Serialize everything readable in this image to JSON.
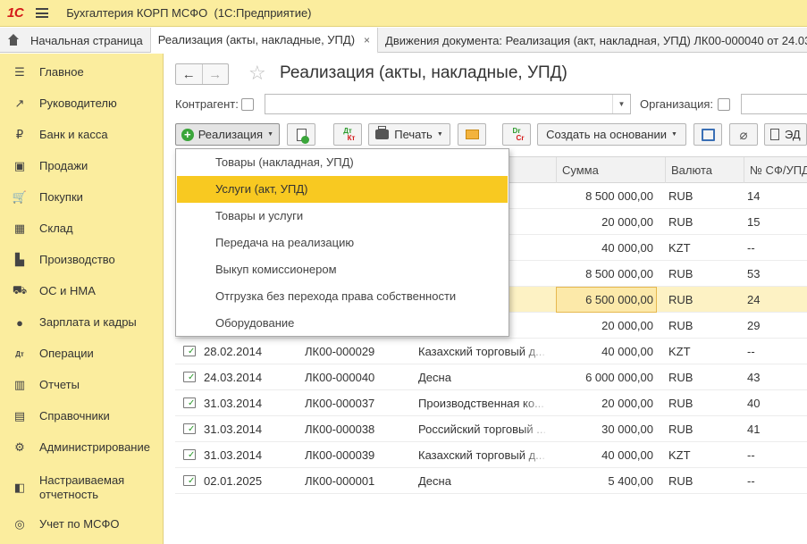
{
  "app": {
    "logo": "1С",
    "title": "Бухгалтерия КОРП МСФО",
    "platform": "(1С:Предприятие)"
  },
  "tabs": [
    {
      "label": "Начальная страница"
    },
    {
      "label": "Реализация (акты, накладные, УПД)",
      "close": "×"
    },
    {
      "label": "Движения документа: Реализация (акт, накладная, УПД) ЛК00-000040 от 24.03"
    }
  ],
  "sidebar": {
    "items": [
      {
        "label": "Главное",
        "icon": "menu-list-icon",
        "glyph": "☰"
      },
      {
        "label": "Руководителю",
        "icon": "trend-chart-icon",
        "glyph": "↗"
      },
      {
        "label": "Банк и касса",
        "icon": "ruble-coin-icon",
        "glyph": "₽"
      },
      {
        "label": "Продажи",
        "icon": "shopping-bag-icon",
        "glyph": "▣"
      },
      {
        "label": "Покупки",
        "icon": "shopping-cart-icon",
        "glyph": "🛒"
      },
      {
        "label": "Склад",
        "icon": "warehouse-grid-icon",
        "glyph": "▦"
      },
      {
        "label": "Производство",
        "icon": "factory-icon",
        "glyph": "▙"
      },
      {
        "label": "ОС и НМА",
        "icon": "truck-icon",
        "glyph": "⛟"
      },
      {
        "label": "Зарплата и кадры",
        "icon": "person-icon",
        "glyph": "●"
      },
      {
        "label": "Операции",
        "icon": "debit-credit-icon",
        "glyph": "Дт"
      },
      {
        "label": "Отчеты",
        "icon": "bar-chart-icon",
        "glyph": "▥"
      },
      {
        "label": "Справочники",
        "icon": "books-icon",
        "glyph": "▤"
      },
      {
        "label": "Администрирование",
        "icon": "gear-icon",
        "glyph": "⚙"
      },
      {
        "label": "Настраиваемая отчетность",
        "icon": "custom-report-icon",
        "glyph": "◧"
      },
      {
        "label": "Учет по МСФО",
        "icon": "globe-icon",
        "glyph": "◎"
      }
    ]
  },
  "document": {
    "title": "Реализация (акты, накладные, УПД)",
    "back": "←",
    "forward": "→",
    "star": "☆"
  },
  "filters": {
    "counterparty_label": "Контрагент:",
    "organization_label": "Организация:"
  },
  "toolbar": {
    "realization_label": "Реализация",
    "print_label": "Печать",
    "create_based_label": "Создать на основании",
    "edo_label": "ЭД",
    "dtkt_top": "Дт",
    "dtkt_bottom": "Кт",
    "drcr_top": "Dr",
    "drcr_bottom": "Cr"
  },
  "dropdown": {
    "items": [
      "Товары (накладная, УПД)",
      "Услуги (акт, УПД)",
      "Товары и услуги",
      "Передача на реализацию",
      "Выкуп комиссионером",
      "Отгрузка без перехода права собственности",
      "Оборудование"
    ],
    "highlighted": "Услуги (акт, УПД)"
  },
  "table": {
    "columns": [
      "Сумма",
      "Валюта",
      "№ СФ/УПД"
    ],
    "rows": [
      {
        "date": "",
        "number": "",
        "counterparty": "",
        "sum": "8 500 000,00",
        "currency": "RUB",
        "invoice": "14"
      },
      {
        "date": "",
        "number": "",
        "counterparty": "ая ко...",
        "sum": "20 000,00",
        "currency": "RUB",
        "invoice": "15"
      },
      {
        "date": "",
        "number": "",
        "counterparty": "овый д...",
        "sum": "40 000,00",
        "currency": "KZT",
        "invoice": "--"
      },
      {
        "date": "",
        "number": "",
        "counterparty": "",
        "sum": "8 500 000,00",
        "currency": "RUB",
        "invoice": "53"
      },
      {
        "date": "",
        "number": "",
        "counterparty": "",
        "sum": "6 500 000,00",
        "currency": "RUB",
        "invoice": "24"
      },
      {
        "date": "",
        "number": "",
        "counterparty": "ая ко...",
        "sum": "20 000,00",
        "currency": "RUB",
        "invoice": "29"
      },
      {
        "date": "28.02.2014",
        "number": "ЛК00-000029",
        "counterparty": "Казахский торговый д...",
        "sum": "40 000,00",
        "currency": "KZT",
        "invoice": "--"
      },
      {
        "date": "24.03.2014",
        "number": "ЛК00-000040",
        "counterparty": "Десна",
        "sum": "6 000 000,00",
        "currency": "RUB",
        "invoice": "43"
      },
      {
        "date": "31.03.2014",
        "number": "ЛК00-000037",
        "counterparty": "Производственная ко...",
        "sum": "20 000,00",
        "currency": "RUB",
        "invoice": "40"
      },
      {
        "date": "31.03.2014",
        "number": "ЛК00-000038",
        "counterparty": "Российский торговый ...",
        "sum": "30 000,00",
        "currency": "RUB",
        "invoice": "41"
      },
      {
        "date": "31.03.2014",
        "number": "ЛК00-000039",
        "counterparty": "Казахский торговый д...",
        "sum": "40 000,00",
        "currency": "KZT",
        "invoice": "--"
      },
      {
        "date": "02.01.2025",
        "number": "ЛК00-000001",
        "counterparty": "Десна",
        "sum": "5 400,00",
        "currency": "RUB",
        "invoice": "--"
      }
    ]
  },
  "colors": {
    "sidebar_bg": "#fbed9e",
    "highlight": "#f8c921",
    "selected_row": "#fdf2c4",
    "logo_red": "#d41a1a",
    "posted_green": "#2c9a2c"
  }
}
